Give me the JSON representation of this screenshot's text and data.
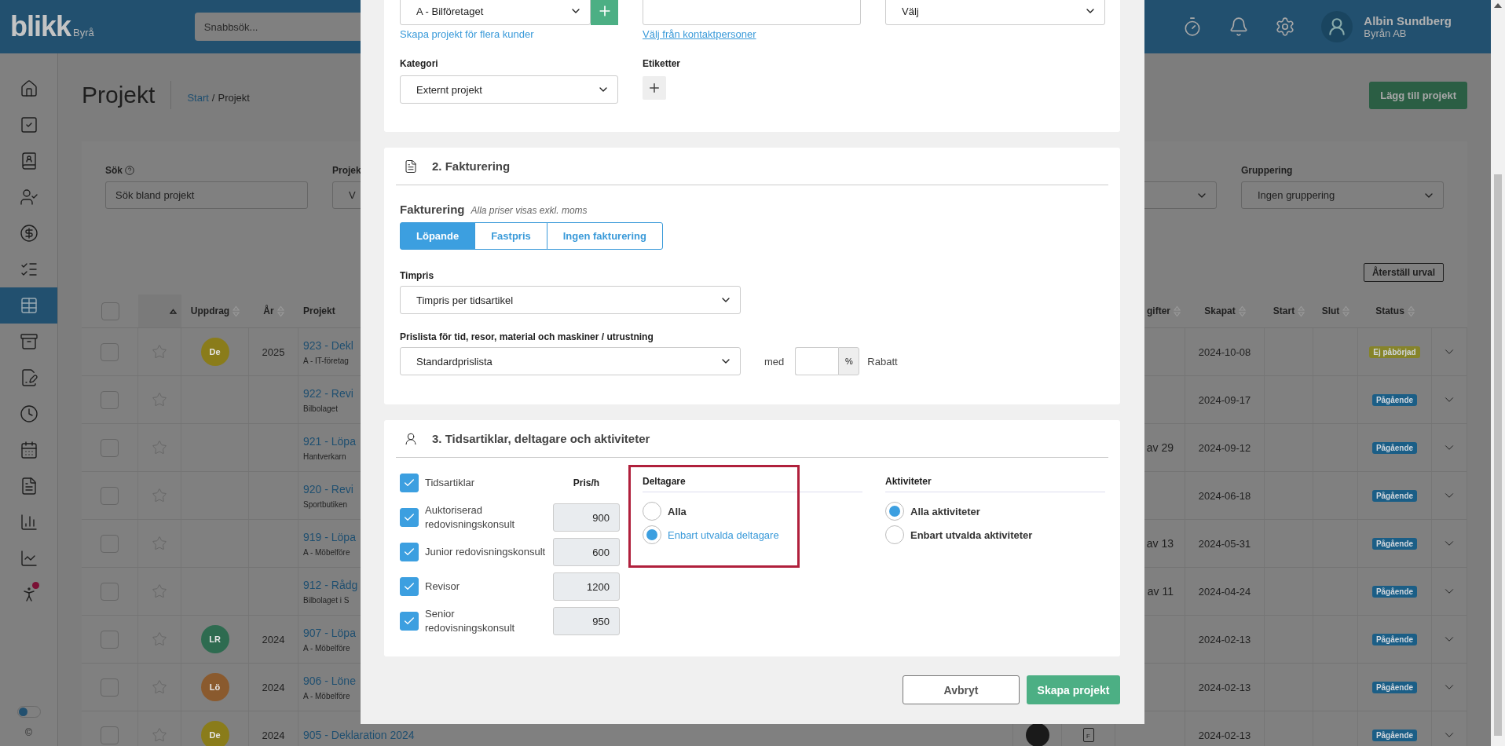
{
  "top_bar": {
    "logo": "blikk",
    "logo_sub": "Byrå",
    "search": {
      "placeholder": "Snabbsök..."
    },
    "user": {
      "name": "Albin Sundberg",
      "company": "Byrån AB"
    }
  },
  "sidebar": {
    "items": [
      {
        "kind": "home",
        "selected": false,
        "badge": false
      },
      {
        "kind": "tasks",
        "selected": false,
        "badge": false
      },
      {
        "kind": "contacts",
        "selected": false,
        "badge": false
      },
      {
        "kind": "users",
        "selected": false,
        "badge": false
      },
      {
        "kind": "money",
        "selected": false,
        "badge": false
      },
      {
        "kind": "checklist",
        "selected": false,
        "badge": false
      },
      {
        "kind": "table",
        "selected": true,
        "badge": false
      },
      {
        "kind": "cabinet",
        "selected": false,
        "badge": false
      },
      {
        "kind": "sign",
        "selected": false,
        "badge": false
      },
      {
        "kind": "time",
        "selected": false,
        "badge": false
      },
      {
        "kind": "calendar",
        "selected": false,
        "badge": false
      },
      {
        "kind": "document",
        "selected": false,
        "badge": false
      },
      {
        "kind": "bars",
        "selected": false,
        "badge": false
      },
      {
        "kind": "trend",
        "selected": false,
        "badge": false
      },
      {
        "kind": "person",
        "selected": false,
        "badge": true
      }
    ],
    "toggle": {
      "on": false
    },
    "footer": "©"
  },
  "page": {
    "title": "Projekt",
    "breadcrumb": {
      "link": "Start",
      "separator": "/",
      "current": "Projekt"
    },
    "add_button": "Lägg till projekt"
  },
  "filters": [
    {
      "kind": "search",
      "label": "Sök",
      "placeholder": "Sök bland projekt"
    },
    {
      "kind": "select",
      "label": "Projek",
      "value": "V"
    },
    {
      "kind": "select"
    },
    {
      "kind": "select",
      "label": "Gruppering",
      "value": "Ingen gruppering"
    }
  ],
  "reset_button": "Återställ urval",
  "table": {
    "columns": [
      {
        "kind": "select",
        "checked": false
      },
      {
        "kind": "favorite",
        "sorted": true
      },
      {
        "label": "Uppdrag",
        "sortable": true
      },
      {
        "label": "År",
        "sortable": true
      },
      {
        "label": "Projekt",
        "sortable": false
      },
      {
        "kind": "hidden"
      },
      {
        "kind": "hidden"
      },
      {
        "label": "gifter",
        "sortable": true
      },
      {
        "label": "Skapat",
        "sortable": true
      },
      {
        "label": "Start",
        "sortable": true
      },
      {
        "label": "Slut",
        "sortable": true
      },
      {
        "label": "Status",
        "sortable": true
      },
      {
        "kind": "expand"
      }
    ],
    "rows": [
      {
        "checked": false,
        "favorite": false,
        "assignee": {
          "initials": "De",
          "color": "#8a7c1a"
        },
        "year": "2025",
        "project": "923 - Dekl",
        "customer": "A - IT-företag",
        "created": "2024-10-08",
        "status": {
          "label": "Ej påbörjad",
          "color": "#86842a"
        }
      },
      {
        "checked": false,
        "favorite": false,
        "project": "922 - Revi",
        "customer": "Bilbolaget",
        "created": "2024-09-17",
        "status": {
          "label": "Pågående",
          "color": "#1b5e86"
        }
      },
      {
        "checked": false,
        "favorite": false,
        "project": "921 - Löpa",
        "customer": "Hantverkarn",
        "expenses": "av 29",
        "created": "2024-09-12",
        "status": {
          "label": "Pågående",
          "color": "#1b5e86"
        }
      },
      {
        "checked": false,
        "favorite": false,
        "project": "920 - Revi",
        "customer": "Sportbutiken",
        "created": "2024-06-18",
        "status": {
          "label": "Pågående",
          "color": "#1b5e86"
        }
      },
      {
        "checked": false,
        "favorite": false,
        "project": "919 - Löpa",
        "customer": "A - Möbelföre",
        "expenses": "av 13",
        "created": "2024-05-31",
        "status": {
          "label": "Pågående",
          "color": "#1b5e86"
        }
      },
      {
        "checked": false,
        "favorite": false,
        "project": "912 - Rådg",
        "customer": "Bilbolaget i S",
        "expenses": "av 11",
        "created": "2024-04-24",
        "status": {
          "label": "Pågående",
          "color": "#1b5e86"
        }
      },
      {
        "checked": false,
        "favorite": false,
        "assignee": {
          "initials": "LR",
          "color": "#2e6b50"
        },
        "year": "2024",
        "project": "907 - Löpa",
        "customer": "A - Möbelföre",
        "created": "2024-02-13",
        "status": {
          "label": "Pågående",
          "color": "#1b5e86"
        }
      },
      {
        "checked": false,
        "favorite": false,
        "assignee": {
          "initials": "Lö",
          "color": "#8a5a2e"
        },
        "year": "2024",
        "project": "906 - Löne",
        "customer": "A - Möbelföre",
        "created": "2024-02-13",
        "status": {
          "label": "Pågående",
          "color": "#1b5e86"
        }
      },
      {
        "checked": false,
        "favorite": false,
        "assignee": {
          "initials": "De",
          "color": "#8a7c1a"
        },
        "year": "2024",
        "project": "905 - Deklaration 2024",
        "photo": true,
        "document": "F",
        "created": "2024-02-13",
        "status": {
          "label": "Pågående",
          "color": "#1b5e86"
        }
      }
    ]
  },
  "modal": {
    "customer_select": {
      "value": "A - Bilföretaget"
    },
    "multi_customer_link": "Skapa projekt för flera kunder",
    "contact_link": "Välj från kontaktpersoner",
    "third_select": {
      "value": "Välj"
    },
    "category": {
      "label": "Kategori",
      "value": "Externt projekt"
    },
    "tags": {
      "label": "Etiketter"
    },
    "billing": {
      "title": "2. Fakturering",
      "label": "Fakturering",
      "note": "Alla priser visas exkl. moms",
      "modes": [
        {
          "label": "Löpande",
          "selected": true
        },
        {
          "label": "Fastpris",
          "selected": false
        },
        {
          "label": "Ingen fakturering",
          "selected": false
        }
      ],
      "hourly": {
        "label": "Timpris",
        "value": "Timpris per tidsartikel"
      },
      "price_list": {
        "label": "Prislista för tid, resor, material och maskiner / utrustning",
        "value": "Standardprislista"
      },
      "discount": {
        "prefix": "med",
        "unit": "%",
        "suffix": "Rabatt"
      }
    },
    "resources": {
      "title": "3. Tidsartiklar, deltagare och aktiviteter",
      "articles": {
        "label": "Tidsartiklar",
        "checked": true,
        "price_header": "Pris/h",
        "items": [
          {
            "name": "Auktoriserad redovisningskonsult",
            "checked": true,
            "price": "900"
          },
          {
            "name": "Junior redovisningskonsult",
            "checked": true,
            "price": "600"
          },
          {
            "name": "Revisor",
            "checked": true,
            "price": "1200"
          },
          {
            "name": "Senior redovisningskonsult",
            "checked": true,
            "price": "950"
          }
        ]
      },
      "participants": {
        "label": "Deltagare",
        "highlighted": true,
        "options": [
          {
            "label": "Alla",
            "selected": false
          },
          {
            "label": "Enbart utvalda deltagare",
            "selected": true
          }
        ]
      },
      "activities": {
        "label": "Aktiviteter",
        "options": [
          {
            "label": "Alla aktiviteter",
            "selected": true
          },
          {
            "label": "Enbart utvalda aktiviteter",
            "selected": false
          }
        ]
      }
    },
    "buttons": {
      "cancel": "Avbryt",
      "submit": "Skapa projekt"
    }
  }
}
